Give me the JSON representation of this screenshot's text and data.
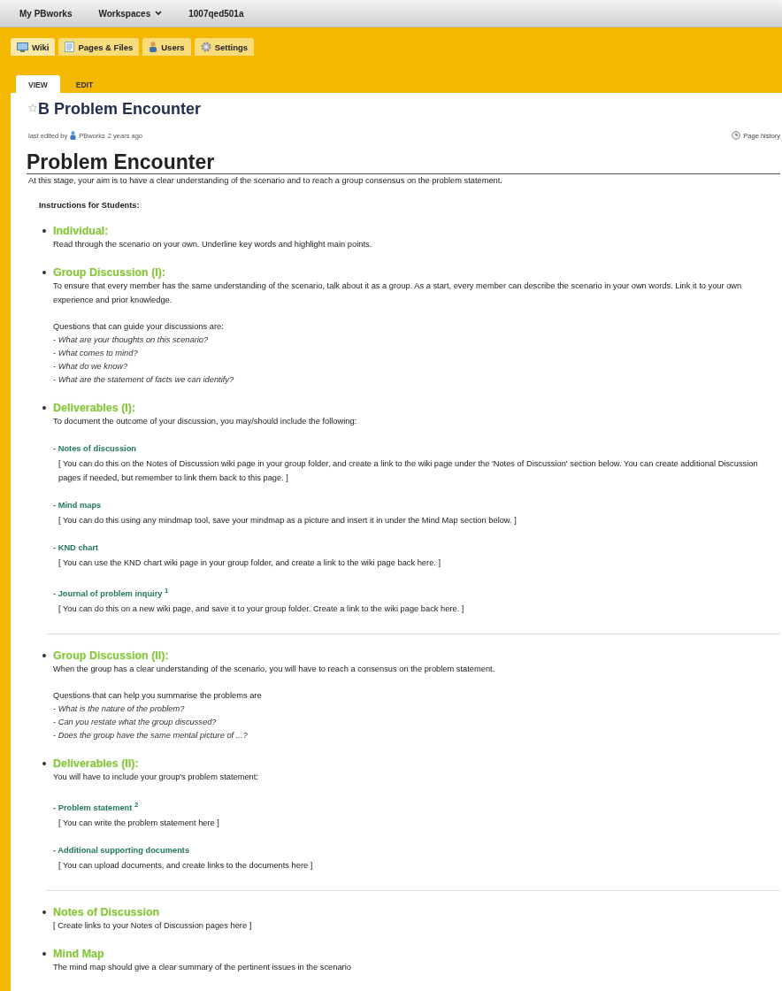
{
  "breadcrumbs": [
    {
      "label": "My PBworks",
      "dropdown": false
    },
    {
      "label": "Workspaces",
      "dropdown": true
    },
    {
      "label": "1007qed501a",
      "dropdown": false
    }
  ],
  "nav_tabs": [
    {
      "label": "Wiki",
      "kind": "wiki",
      "selected": true
    },
    {
      "label": "Pages & Files",
      "kind": "pages",
      "selected": false
    },
    {
      "label": "Users",
      "kind": "users",
      "selected": false
    },
    {
      "label": "Settings",
      "kind": "settings",
      "selected": false
    }
  ],
  "view_tabs": [
    {
      "label": "VIEW",
      "selected": true
    },
    {
      "label": "EDIT",
      "selected": false
    }
  ],
  "page_title": "B Problem Encounter",
  "meta": {
    "prefix": "last edited by",
    "author": "PBworks",
    "age": "2 years ago",
    "history_link": "Page history"
  },
  "heading": "Problem Encounter",
  "intro": "At this stage, your aim is to have a clear understanding of the scenario and to reach a group consensus on the problem statement.",
  "instructions_label": "Instructions for Students:",
  "groups": [
    {
      "items": [
        {
          "heading": "Individual:",
          "blocks": [
            {
              "kind": "text",
              "lines": [
                "Read through the scenario on your own. Underline key words and highlight main points."
              ]
            }
          ]
        },
        {
          "heading": "Group Discussion (I):",
          "blocks": [
            {
              "kind": "text",
              "lines": [
                "To ensure that every member has the same understanding of the scenario, talk about it as a group. As a start, every member can describe the scenario in your own words. Link it to your own experience and prior knowledge."
              ]
            },
            {
              "kind": "questions",
              "intro": "Questions that can guide your discussions are:",
              "questions": [
                "- *What are your thoughts on this scenario?*",
                "- *What comes to mind?*",
                "- *What do we know?*",
                "- *What are the statement of facts we can identify?*"
              ]
            }
          ]
        },
        {
          "heading": "Deliverables (I):",
          "blocks": [
            {
              "kind": "text",
              "lines": [
                "To document the outcome of your discussion, you may/should include the following:"
              ]
            },
            {
              "kind": "deliverable",
              "title": "- Notes of discussion",
              "note": "[ You can do this on the Notes of Discussion wiki page in your group folder, and create a link to the wiki page under the 'Notes of Discussion' section below. You can create additional Discussion pages if needed, but remember to link them back to this page. ]"
            },
            {
              "kind": "deliverable",
              "title": "- Mind maps",
              "note": "[ You can do this using any mindmap tool, save your mindmap as a picture and insert it in under the Mind Map section below. ]"
            },
            {
              "kind": "deliverable",
              "title": "- KND chart",
              "note": "[ You can use the KND chart wiki page in your group folder, and create a link to the wiki page back here. ]"
            },
            {
              "kind": "deliverable",
              "title": "- Journal of problem inquiry $^{1}$",
              "note": "[ You can do this on a new wiki page, and save it to your group folder. Create a link to the wiki page back here. ]"
            }
          ]
        }
      ]
    },
    {
      "items": [
        {
          "heading": "Group Discussion (II):",
          "blocks": [
            {
              "kind": "text",
              "lines": [
                "When the group has a clear understanding of the scenario, you will have to reach a consensus on the problem statement."
              ]
            },
            {
              "kind": "questions",
              "intro": "Questions that can help you summarise the problems are",
              "questions": [
                "- *What is the nature of the problem?*",
                "- *Can you restate what the group discussed?*",
                "- *Does the group have the same mental picture of ...?*"
              ]
            }
          ]
        },
        {
          "heading": "Deliverables (II):",
          "blocks": [
            {
              "kind": "text",
              "lines": [
                "You will have to include your group's problem statement:"
              ]
            },
            {
              "kind": "deliverable",
              "title": "- Problem statement $^{2}$",
              "note": "[ You can write the problem statement here ]"
            },
            {
              "kind": "deliverable",
              "title": "- Additional supporting documents",
              "note": "[ You can upload documents, and create links to the documents here ]"
            }
          ]
        }
      ]
    },
    {
      "items": [
        {
          "heading": "Notes of Discussion",
          "blocks": [
            {
              "kind": "text",
              "lines": [
                "[ Create links to your Notes of Discussion pages here ]"
              ]
            }
          ]
        },
        {
          "heading": "Mind Map",
          "blocks": [
            {
              "kind": "text",
              "lines": [
                "The mind map should give a clear summary of the pertinent issues in the scenario"
              ]
            }
          ]
        }
      ]
    }
  ]
}
